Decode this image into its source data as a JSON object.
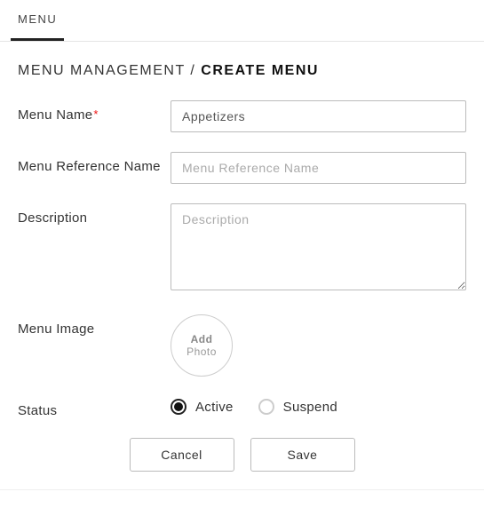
{
  "tabs": {
    "primary_label": "MENU"
  },
  "breadcrumb": {
    "parent": "MENU MANAGEMENT",
    "separator": " / ",
    "current": "CREATE MENU"
  },
  "form": {
    "name": {
      "label": "Menu Name",
      "required_marker": "*",
      "value": "Appetizers"
    },
    "reference": {
      "label": "Menu Reference Name",
      "placeholder": "Menu Reference Name",
      "value": ""
    },
    "description": {
      "label": "Description",
      "placeholder": "Description",
      "value": ""
    },
    "image": {
      "label": "Menu Image",
      "uploader_line1": "Add",
      "uploader_line2": "Photo"
    },
    "status": {
      "label": "Status",
      "options": {
        "active": {
          "label": "Active",
          "selected": true
        },
        "suspend": {
          "label": "Suspend",
          "selected": false
        }
      }
    }
  },
  "buttons": {
    "cancel": "Cancel",
    "save": "Save"
  }
}
